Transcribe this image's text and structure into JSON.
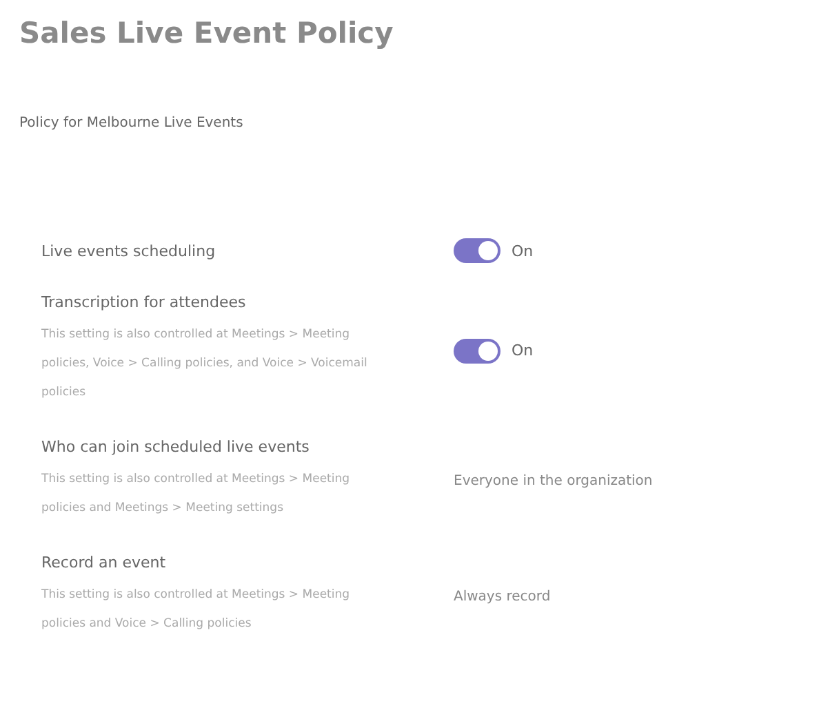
{
  "title": "Sales Live Event Policy",
  "description": "Policy for Melbourne Live Events",
  "settings": [
    {
      "label": "Live events scheduling",
      "kind": "toggle",
      "on": true,
      "value": "On"
    },
    {
      "label": "Transcription for attendees",
      "note": "This setting is also controlled at Meetings > Meeting policies, Voice > Calling policies, and Voice > Voicemail policies",
      "kind": "toggle",
      "on": true,
      "value": "On"
    },
    {
      "label": "Who can join scheduled live events",
      "note": "This setting is also controlled at Meetings > Meeting policies and Meetings > Meeting settings",
      "kind": "text",
      "value": "Everyone in the organization"
    },
    {
      "label": "Record an event",
      "note": "This setting is also controlled at Meetings > Meeting policies and Voice > Calling policies",
      "kind": "text",
      "value": "Always record"
    }
  ]
}
